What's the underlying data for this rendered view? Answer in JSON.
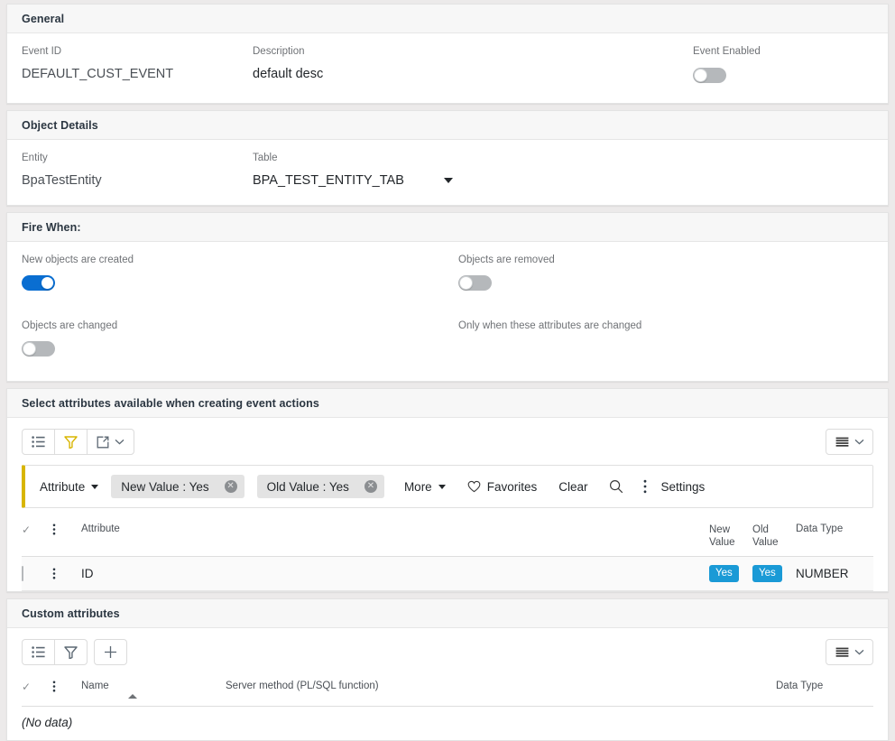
{
  "general": {
    "header": "General",
    "event_id_label": "Event ID",
    "event_id_value": "DEFAULT_CUST_EVENT",
    "description_label": "Description",
    "description_value": "default desc",
    "event_enabled_label": "Event Enabled",
    "event_enabled_state": "off"
  },
  "object_details": {
    "header": "Object Details",
    "entity_label": "Entity",
    "entity_value": "BpaTestEntity",
    "table_label": "Table",
    "table_value": "BPA_TEST_ENTITY_TAB"
  },
  "fire_when": {
    "header": "Fire When:",
    "new_objects_label": "New objects are created",
    "new_objects_state": "on",
    "objects_removed_label": "Objects are removed",
    "objects_removed_state": "off",
    "objects_changed_label": "Objects are changed",
    "objects_changed_state": "off",
    "only_when_label": "Only when these attributes are changed"
  },
  "attributes_section": {
    "header": "Select attributes available when creating event actions",
    "toolbar": {
      "list_icon": "list-icon",
      "filter_icon": "funnel-icon",
      "export_icon": "export-icon",
      "export_caret_icon": "chevron-down-icon",
      "view_icon": "view-density-icon",
      "view_caret_icon": "chevron-down-icon"
    },
    "filterbar": {
      "attribute_label": "Attribute",
      "chips": [
        {
          "label": "New Value : Yes"
        },
        {
          "label": "Old Value : Yes"
        }
      ],
      "more_label": "More",
      "favorites_label": "Favorites",
      "favorites_icon": "heart-icon",
      "clear_label": "Clear",
      "search_icon": "search-icon",
      "overflow_icon": "more-vertical-icon",
      "settings_label": "Settings"
    },
    "columns": [
      "Attribute",
      "New Value",
      "Old Value",
      "Data Type"
    ],
    "rows": [
      {
        "attribute": "ID",
        "new_value": "Yes",
        "old_value": "Yes",
        "data_type": "NUMBER",
        "selected": false
      }
    ]
  },
  "custom_attributes": {
    "header": "Custom attributes",
    "toolbar": {
      "list_icon": "list-icon",
      "filter_icon": "funnel-icon",
      "add_icon": "plus-icon",
      "view_icon": "view-density-icon",
      "view_caret_icon": "chevron-down-icon"
    },
    "columns": [
      "Name",
      "Server method (PL/SQL function)",
      "Data Type"
    ],
    "empty_text": "(No data)"
  },
  "colors": {
    "accent_blue": "#0a6ed1",
    "badge_blue": "#1a9ad6",
    "filter_gold": "#d8b500",
    "panel_header_bg": "#f7f7f7",
    "page_bg": "#eceaea"
  }
}
